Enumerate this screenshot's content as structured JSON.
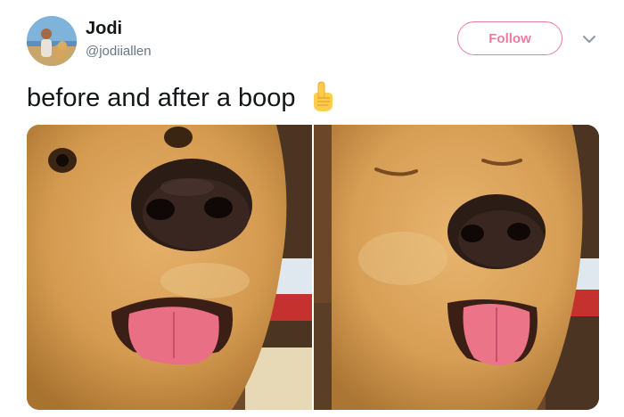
{
  "author": {
    "display_name": "Jodi",
    "handle": "@jodiiallen",
    "avatar_icon": "profile-photo"
  },
  "follow_button": {
    "label": "Follow",
    "color": "#e0245e"
  },
  "menu": {
    "icon": "chevron-down-icon"
  },
  "tweet": {
    "text": "before and after a boop",
    "emoji_icon": "pointing-up-hand-emoji"
  },
  "media": {
    "photos": [
      {
        "icon": "dog-before-boop-photo"
      },
      {
        "icon": "dog-after-boop-photo"
      }
    ]
  },
  "colors": {
    "name": "#14171a",
    "handle": "#657786",
    "accent": "#e0245e"
  }
}
